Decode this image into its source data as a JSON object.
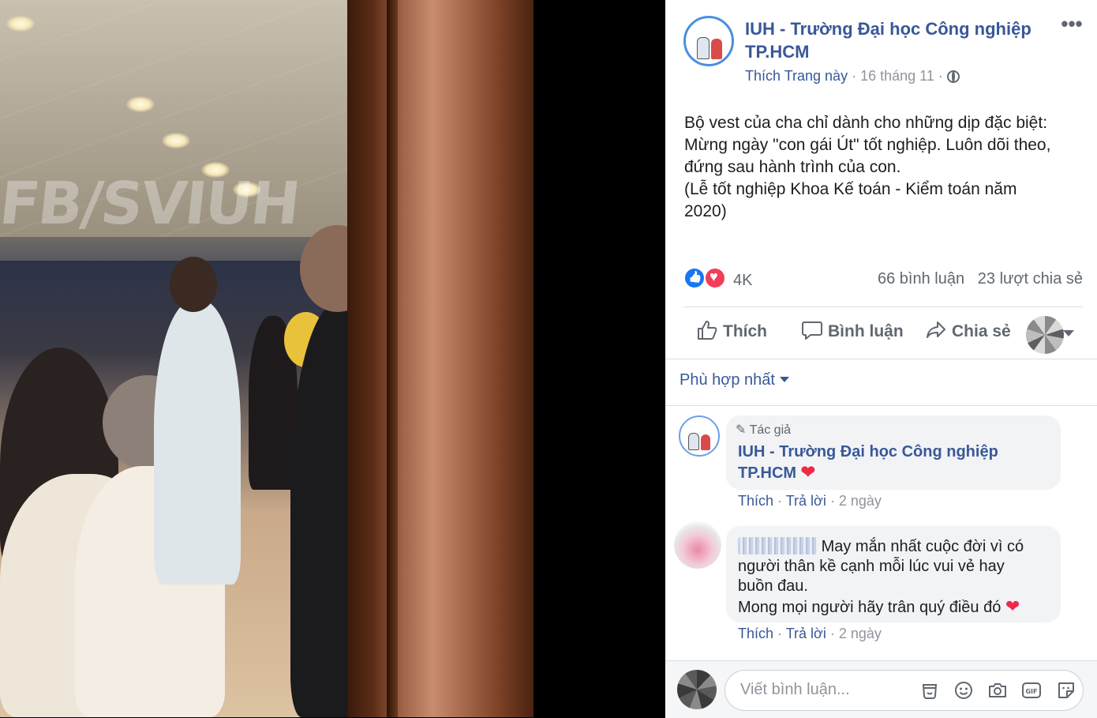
{
  "post": {
    "page_name": "IUH - Trường Đại học Công nghiệp TP.HCM",
    "like_page": "Thích Trang này",
    "date": "16 tháng 11",
    "separator": "·",
    "text_lines": [
      "Bộ vest của cha chỉ dành cho những dịp đặc biệt:",
      "Mừng ngày \"con gái Út\" tốt nghiệp. Luôn dõi theo,",
      "đứng sau hành trình của con.",
      "(Lễ tốt nghiệp Khoa Kế toán - Kiểm toán năm",
      "2020)"
    ],
    "reaction_count": "4K",
    "comments_count": "66 bình luận",
    "shares_count": "23 lượt chia sẻ"
  },
  "photo": {
    "watermark": "FB/SVIUH"
  },
  "actions": {
    "like": "Thích",
    "comment": "Bình luận",
    "share": "Chia sẻ"
  },
  "sort": {
    "label": "Phù hợp nhất"
  },
  "comments": [
    {
      "badge": "Tác giả",
      "author_line1": "IUH - Trường Đại học Công nghiệp",
      "author_line2": "TP.HCM",
      "like": "Thích",
      "reply": "Trả lời",
      "time": "2 ngày"
    },
    {
      "text_line1": "May mắn nhất cuộc đời vì có",
      "text_line2": "người thân kề cạnh mỗi lúc vui vẻ hay",
      "text_line3": "buồn đau.",
      "text_line4": "Mong mọi người hãy trân quý điều đó",
      "like": "Thích",
      "reply": "Trả lời",
      "time": "2 ngày"
    }
  ],
  "composer": {
    "placeholder": "Viết bình luận..."
  },
  "icons": {
    "more": "more-dots-icon",
    "globe": "globe-icon",
    "like": "thumbs-up-icon",
    "comment": "speech-bubble-icon",
    "share": "share-arrow-icon",
    "sticker": "sticker-icon",
    "emoji": "emoji-icon",
    "camera": "camera-icon",
    "gif": "gif-icon"
  },
  "colors": {
    "link": "#385898",
    "meta": "#90949c",
    "text": "#1c1e21",
    "like_blue": "#1877f2",
    "love_red": "#f33e58"
  }
}
